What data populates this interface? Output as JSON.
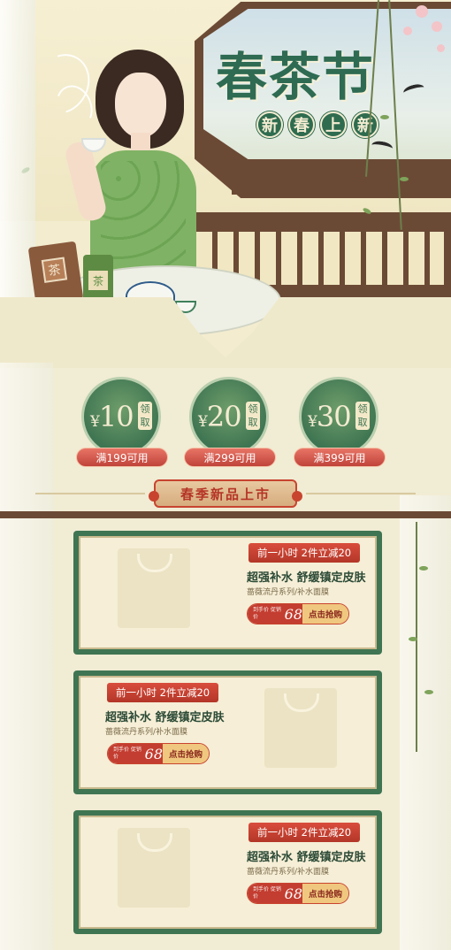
{
  "hero": {
    "title": "春茶节",
    "subtitle_chars": [
      "新",
      "春",
      "上",
      "新"
    ],
    "tea_bag_label": "茶",
    "tea_can_label": "茶"
  },
  "coupons": [
    {
      "yen": "¥",
      "amount": "10",
      "get_label": "领取",
      "condition": "满199可用"
    },
    {
      "yen": "¥",
      "amount": "20",
      "get_label": "领取",
      "condition": "满299可用"
    },
    {
      "yen": "¥",
      "amount": "30",
      "get_label": "领取",
      "condition": "满399可用"
    }
  ],
  "section": {
    "heading": "春季新品上市"
  },
  "products": [
    {
      "tag": "前一小时 2件立减20",
      "title": "超强补水 舒缓镇定皮肤",
      "subtitle": "蔷薇流丹系列/补水面膜",
      "price_caption": "到手价 促销价",
      "price": "68",
      "buy_label": "点击抢购"
    },
    {
      "tag": "前一小时 2件立减20",
      "title": "超强补水 舒缓镇定皮肤",
      "subtitle": "蔷薇流丹系列/补水面膜",
      "price_caption": "到手价 促销价",
      "price": "68",
      "buy_label": "点击抢购"
    },
    {
      "tag": "前一小时 2件立减20",
      "title": "超强补水 舒缓镇定皮肤",
      "subtitle": "蔷薇流丹系列/补水面膜",
      "price_caption": "到手价 促销价",
      "price": "68",
      "buy_label": "点击抢购"
    }
  ],
  "colors": {
    "background": "#f1ecd4",
    "green": "#3f7552",
    "red": "#c33d30",
    "wood": "#6b4a35"
  }
}
